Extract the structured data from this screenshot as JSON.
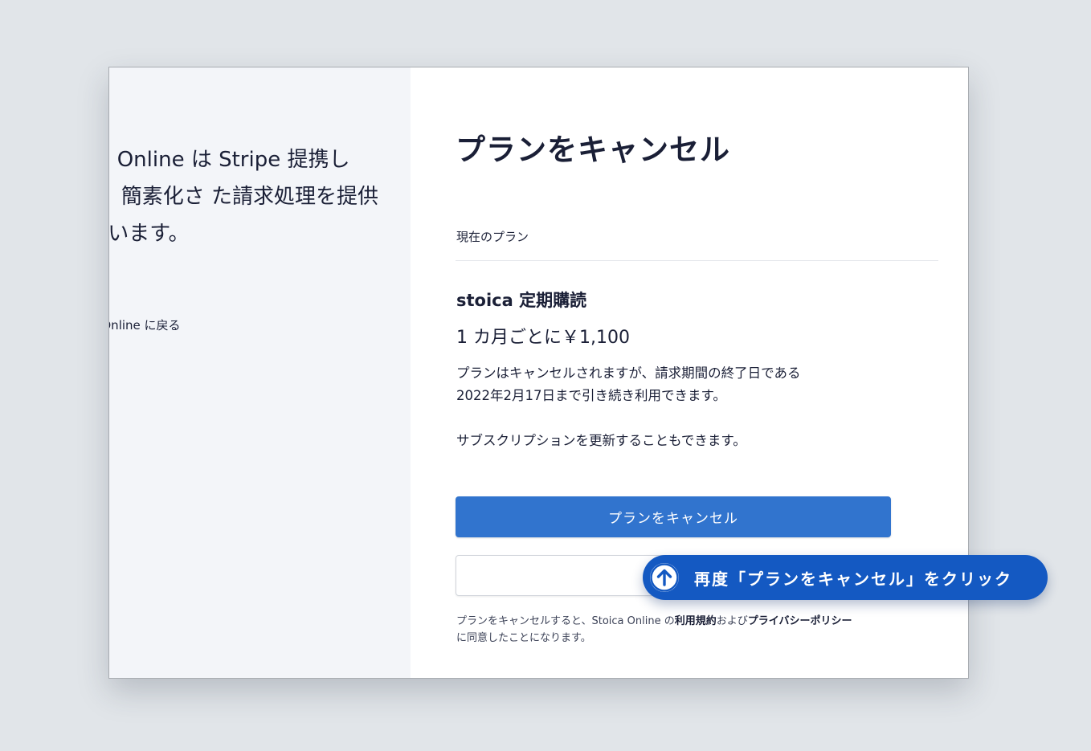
{
  "left_panel": {
    "intro_text": "ica Online は Stripe 提携して、簡素化さ た請求処理を提供し います。",
    "back_link": "ica Online に戻る"
  },
  "main": {
    "title": "プランをキャンセル",
    "current_plan_label": "現在のプラン",
    "product_name": "stoica 定期購読",
    "price": "1 カ月ごとに￥1,100",
    "notice_line1": "プランはキャンセルされますが、請求期間の終了日である",
    "notice_line2": "2022年2月17日まで引き続き利用できます。",
    "renew_text": "サブスクリプションを更新することもできます。",
    "cancel_button_label": "プランをキャンセル",
    "back_button_label": "",
    "terms": {
      "prefix": "プランをキャンセルすると、Stoica Online の",
      "terms_link": "利用規約",
      "middle": "および",
      "privacy_link": "プライバシーポリシー",
      "suffix": "に同意したことになります。"
    }
  },
  "callout": {
    "text": "再度「プランをキャンセル」をクリック",
    "icon": "arrow-up-circle-icon"
  },
  "colors": {
    "background": "#e1e5e9",
    "left_panel": "#f3f5f9",
    "primary_button": "#3174ce",
    "callout": "#1459c2"
  }
}
